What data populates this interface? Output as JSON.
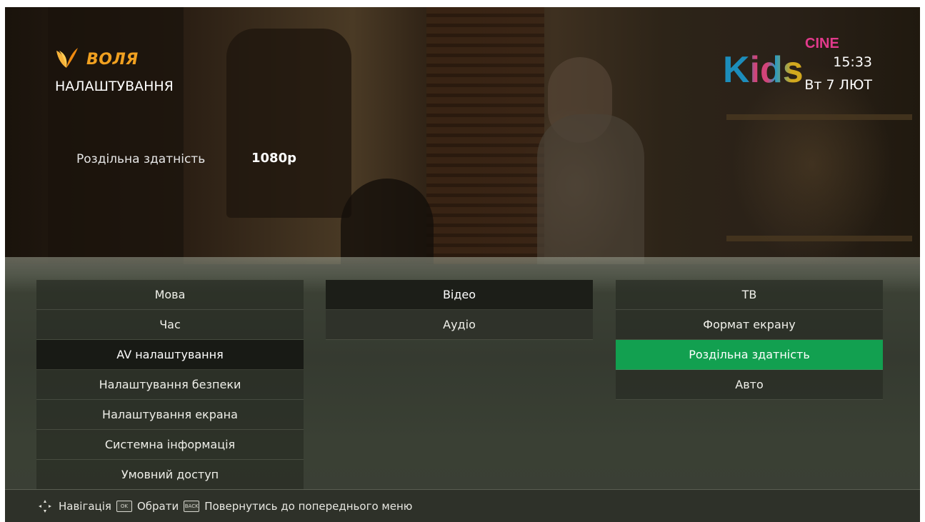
{
  "brand": {
    "name": "ВОЛЯ",
    "accent": "#f0a020"
  },
  "header": {
    "title": "НАЛАШТУВАННЯ",
    "info_label": "Роздільна здатність",
    "info_value": "1080p",
    "time": "15:33",
    "date": "Вт 7 ЛЮТ",
    "channel_logo": {
      "main": "Kids",
      "sup": "CINE"
    }
  },
  "menu_main": {
    "items": [
      {
        "label": "Мова"
      },
      {
        "label": "Час"
      },
      {
        "label": "AV налаштування",
        "state": "active"
      },
      {
        "label": "Налаштування безпеки"
      },
      {
        "label": "Налаштування екрана"
      },
      {
        "label": "Системна інформація"
      },
      {
        "label": "Умовний доступ"
      }
    ]
  },
  "menu_av": {
    "items": [
      {
        "label": "Відео",
        "state": "active"
      },
      {
        "label": "Аудіо"
      }
    ]
  },
  "menu_video": {
    "items": [
      {
        "label": "ТВ"
      },
      {
        "label": "Формат екрану"
      },
      {
        "label": "Роздільна здатність",
        "state": "selected"
      },
      {
        "label": "Авто"
      }
    ]
  },
  "footer": {
    "navigate": "Навігація",
    "ok_key": "OK",
    "select": "Обрати",
    "back_key": "BACK",
    "back": "Повернутись до попереднього меню"
  },
  "colors": {
    "selected": "#12a050"
  },
  "icons": [
    "dpad-icon",
    "ok-key-icon",
    "back-key-icon",
    "volia-leaf-icon"
  ]
}
